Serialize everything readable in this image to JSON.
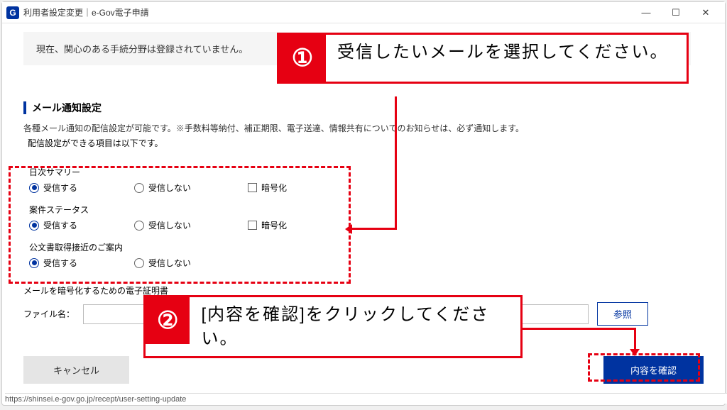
{
  "window": {
    "app_icon_letter": "G",
    "title": "利用者設定変更｜e-Gov電子申請"
  },
  "notice": "現在、関心のある手続分野は登録されていません。",
  "section": {
    "header": "メール通知設定",
    "desc1": "各種メール通知の配信設定が可能です。※手数料等納付、補正期限、電子送達、情報共有についてのお知らせは、必ず通知します。",
    "desc2": "配信設定ができる項目は以下です。"
  },
  "groups": [
    {
      "title": "日次サマリー",
      "opt_receive": "受信する",
      "opt_noreceive": "受信しない",
      "encrypt": "暗号化",
      "has_encrypt": true
    },
    {
      "title": "案件ステータス",
      "opt_receive": "受信する",
      "opt_noreceive": "受信しない",
      "encrypt": "暗号化",
      "has_encrypt": true
    },
    {
      "title": "公文書取得接近のご案内",
      "opt_receive": "受信する",
      "opt_noreceive": "受信しない",
      "has_encrypt": false
    }
  ],
  "cert": {
    "label": "メールを暗号化するための電子証明書",
    "file_label": "ファイル名：",
    "browse": "参照"
  },
  "buttons": {
    "cancel": "キャンセル",
    "confirm": "内容を確認"
  },
  "status_url": "https://shinsei.e-gov.go.jp/recept/user-setting-update",
  "annotations": {
    "c1_num": "①",
    "c1_text": "受信したいメールを選択してください。",
    "c2_num": "②",
    "c2_text": "[内容を確認]をクリックしてください。"
  }
}
